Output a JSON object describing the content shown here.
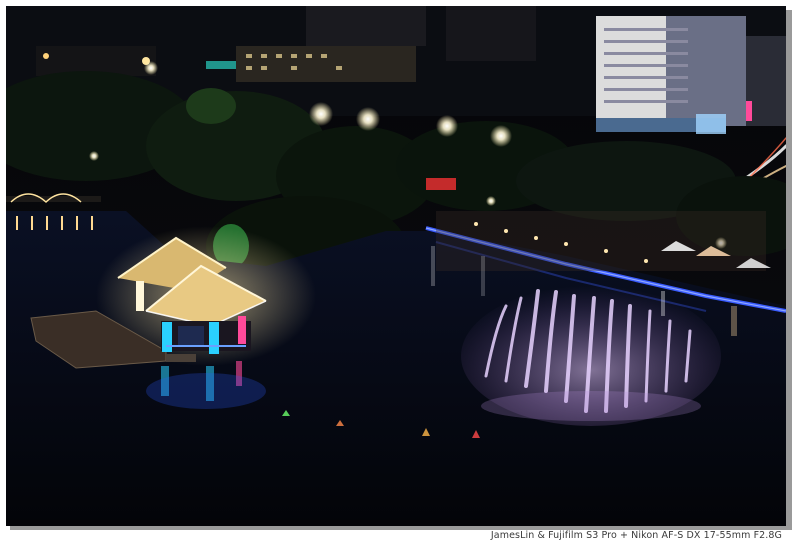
{
  "photo": {
    "caption": "JamesLin & Fujifilm S3 Pro + Nikon AF-S DX 17-55mm F2.8G"
  },
  "colors": {
    "frame": "#ffffff",
    "sky": "#050508",
    "water": "#060914",
    "neon_blue": "#3a5cff",
    "pavilion_gold": "#f2d58a",
    "fountain": "#c9a6e8",
    "tree_dark": "#0c160e"
  }
}
